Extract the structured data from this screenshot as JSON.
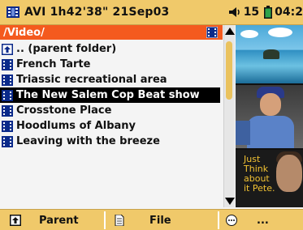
{
  "topbar": {
    "title": "AVI 1h42'38\" 21Sep03",
    "volume": "15",
    "time": "04:2",
    "icons": [
      "film-icon",
      "speaker-icon",
      "battery-icon"
    ]
  },
  "path": {
    "label": "/Video/",
    "icon": "film-icon"
  },
  "files": [
    {
      "label": ".. (parent folder)",
      "icon": "up-folder-icon",
      "selected": false
    },
    {
      "label": "French Tarte",
      "icon": "film-icon",
      "selected": false
    },
    {
      "label": "Triassic recreational area",
      "icon": "film-icon",
      "selected": false
    },
    {
      "label": "The New Salem Cop Beat show",
      "icon": "film-icon",
      "selected": true
    },
    {
      "label": "Crosstone Place",
      "icon": "film-icon",
      "selected": false
    },
    {
      "label": "Hoodlums of Albany",
      "icon": "film-icon",
      "selected": false
    },
    {
      "label": "Leaving with the breeze",
      "icon": "film-icon",
      "selected": false
    }
  ],
  "thumbnails": {
    "ad_text": [
      "Just",
      "Think",
      "about",
      "it Pete."
    ]
  },
  "bottombar": {
    "parent_label": "Parent",
    "file_label": "File",
    "more_label": "..."
  },
  "colors": {
    "accent": "#f0c96a",
    "path_bar": "#f45a1e",
    "selection": "#000000"
  }
}
